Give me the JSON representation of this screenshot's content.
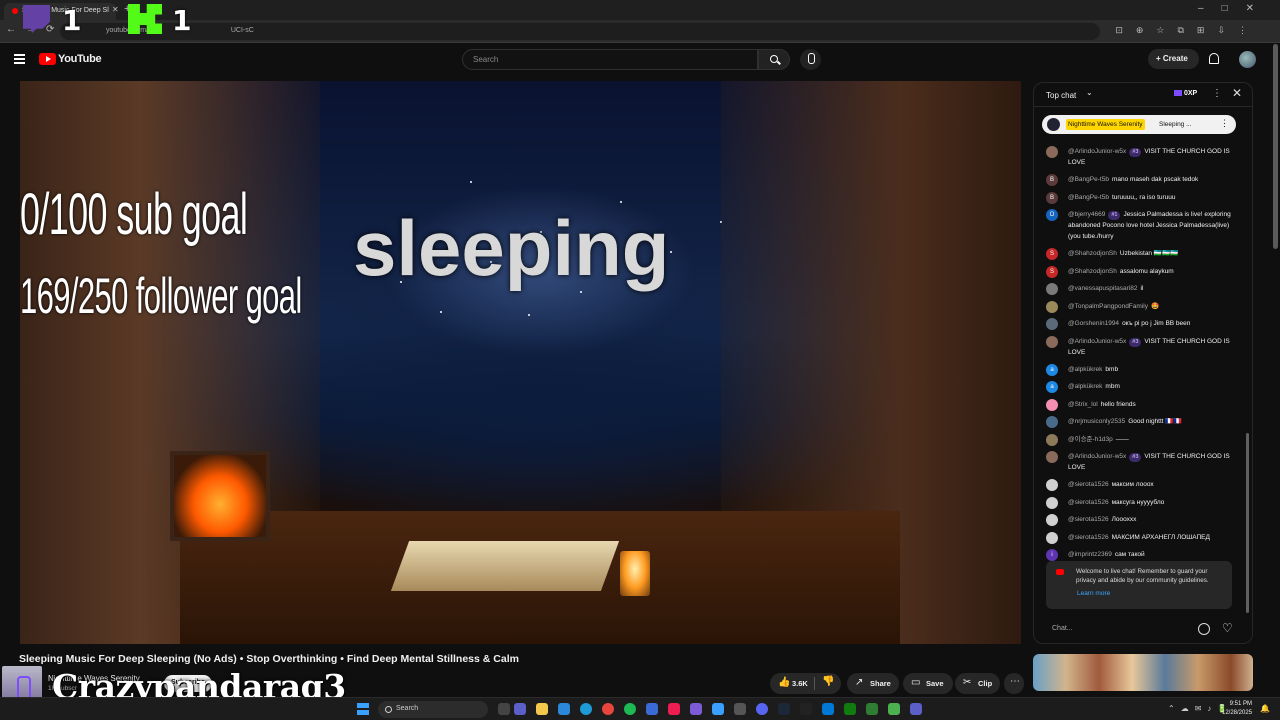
{
  "browser": {
    "tab_title": "Sleeping Music For Deep Sl",
    "url": "youtube.com/wat",
    "url_suffix": "UCI-sC"
  },
  "overlay": {
    "twitch_count": "1",
    "kick_count": "1",
    "sub_goal": "0/100 sub goal",
    "follower_goal": "169/250 follower goal",
    "sleeping": "sleeping",
    "kick_username": "Crazypandarag3"
  },
  "header": {
    "logo_text": "YouTube",
    "search_placeholder": "Search",
    "create_label": "Create"
  },
  "chat": {
    "title": "Top chat",
    "xp": "0XP",
    "pinned": {
      "name": "Nighttime Waves Serenity",
      "text": "Sleeping ..."
    },
    "messages": [
      {
        "author": "@ArlindoJunior-w5x",
        "badge": "#3",
        "text": "VISIT THE CHURCH GOD IS LOVE",
        "avatar_color": "#8a6a5a",
        "initial": ""
      },
      {
        "author": "@BangPe-t5b",
        "badge": "",
        "text": "mano maseh dak pscak tedok",
        "avatar_color": "#5a3a3a",
        "initial": "B"
      },
      {
        "author": "@BangPe-t5b",
        "badge": "",
        "text": "turuuuu,, ra iso turuuu",
        "avatar_color": "#5a3a3a",
        "initial": "B"
      },
      {
        "author": "@bjerry4669",
        "badge": "#1",
        "text": "Jessica Palmadessa is live! exploring abandoned Pocono love hotel Jessica Palmadessa(live)(you tube./hurry",
        "avatar_color": "#1565c0",
        "initial": "O"
      },
      {
        "author": "@ShahzodjonSh",
        "badge": "",
        "text": "Uzbekistan 🇺🇿🇺🇿🇺🇿",
        "avatar_color": "#c62828",
        "initial": "S"
      },
      {
        "author": "@ShahzodjonSh",
        "badge": "",
        "text": "assalomu alaykum",
        "avatar_color": "#c62828",
        "initial": "S"
      },
      {
        "author": "@vanessapuspitasari82",
        "badge": "",
        "text": "il",
        "avatar_color": "#7a7a7a",
        "initial": ""
      },
      {
        "author": "@TonpalmPangpondFamily",
        "badge": "",
        "text": "🤩",
        "avatar_color": "#9a8a5a",
        "initial": ""
      },
      {
        "author": "@Gorshenin1994",
        "badge": "",
        "text": "окъ рі ро j Jim BB been",
        "avatar_color": "#5a6a7a",
        "initial": ""
      },
      {
        "author": "@ArlindoJunior-w5x",
        "badge": "#3",
        "text": "VISIT THE CHURCH GOD IS LOVE",
        "avatar_color": "#8a6a5a",
        "initial": ""
      },
      {
        "author": "@alpkükrek",
        "badge": "",
        "text": "bmb",
        "avatar_color": "#1e88e5",
        "initial": "a"
      },
      {
        "author": "@alpkükrek",
        "badge": "",
        "text": "mbm",
        "avatar_color": "#1e88e5",
        "initial": "a"
      },
      {
        "author": "@Strix_lol",
        "badge": "",
        "text": "hello friends",
        "avatar_color": "#f48fb1",
        "initial": ""
      },
      {
        "author": "@nrjmusiconly2535",
        "badge": "",
        "text": "Good nighttt 🇫🇷🇫🇷",
        "avatar_color": "#4a6a8a",
        "initial": ""
      },
      {
        "author": "@이승준-h1d3p",
        "badge": "",
        "text": "——",
        "avatar_color": "#8a7a5a",
        "initial": ""
      },
      {
        "author": "@ArlindoJunior-w5x",
        "badge": "#3",
        "text": "VISIT THE CHURCH GOD IS LOVE",
        "avatar_color": "#8a6a5a",
        "initial": ""
      },
      {
        "author": "@sierota1526",
        "badge": "",
        "text": "максим лооох",
        "avatar_color": "#d0d0d0",
        "initial": ""
      },
      {
        "author": "@sierota1526",
        "badge": "",
        "text": "максуга нуууубло",
        "avatar_color": "#d0d0d0",
        "initial": ""
      },
      {
        "author": "@sierota1526",
        "badge": "",
        "text": "Лоооххх",
        "avatar_color": "#d0d0d0",
        "initial": ""
      },
      {
        "author": "@sierota1526",
        "badge": "",
        "text": "МАКСИМ АРХАНЕГЛ ЛОШАПЕД",
        "avatar_color": "#d0d0d0",
        "initial": ""
      },
      {
        "author": "@imprintz2369",
        "badge": "",
        "text": "сам такой",
        "avatar_color": "#5e35b1",
        "initial": "i"
      }
    ],
    "welcome_text": "Welcome to live chat! Remember to guard your privacy and abide by our community guidelines.",
    "welcome_link": "Learn more",
    "input_placeholder": "Chat..."
  },
  "video": {
    "title": "Sleeping Music For Deep Sleeping (No Ads) • Stop Overthinking • Find Deep Mental Stillness & Calm",
    "channel": "Nighttime Waves Serenity",
    "subs": "1K subscr",
    "subscribe": "Subscribe",
    "likes": "3.6K",
    "share": "Share",
    "save": "Save",
    "clip": "Clip"
  },
  "taskbar": {
    "search": "Search",
    "time": "9:51 PM",
    "date": "12/28/2025"
  }
}
